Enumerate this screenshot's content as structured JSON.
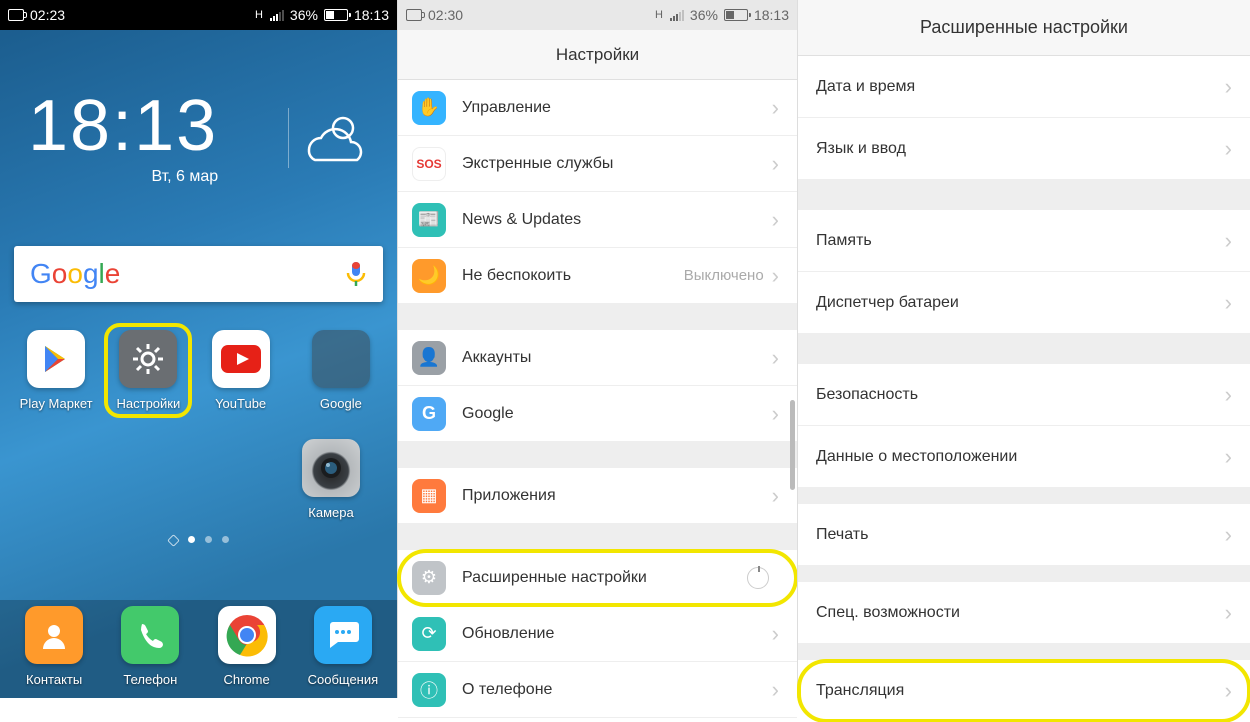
{
  "panel1": {
    "status": {
      "rec_time": "02:23",
      "signal_label": "H",
      "battery_pct": "36%",
      "clock": "18:13"
    },
    "clock": {
      "time": "18:13",
      "date": "Вт, 6 мар"
    },
    "search": {
      "logo": "Google"
    },
    "apps_row1": [
      {
        "name": "Play Маркет"
      },
      {
        "name": "Настройки"
      },
      {
        "name": "YouTube"
      },
      {
        "name": "Google"
      }
    ],
    "apps_row2": [
      {
        "name": "Камера"
      }
    ],
    "dock": [
      {
        "name": "Контакты"
      },
      {
        "name": "Телефон"
      },
      {
        "name": "Chrome"
      },
      {
        "name": "Сообщения"
      }
    ]
  },
  "panel2": {
    "status": {
      "rec_time": "02:30",
      "signal_label": "H",
      "battery_pct": "36%",
      "clock": "18:13"
    },
    "title": "Настройки",
    "items": [
      {
        "label": "Управление",
        "icon_bg": "#35b4ff",
        "glyph": "hand"
      },
      {
        "label": "Экстренные службы",
        "icon_bg": "#ffffff",
        "glyph": "sos"
      },
      {
        "label": "News & Updates",
        "icon_bg": "#2fc0b6",
        "glyph": "news"
      },
      {
        "label": "Не беспокоить",
        "icon_bg": "#ff9a2b",
        "glyph": "dnd",
        "value": "Выключено"
      }
    ],
    "items2": [
      {
        "label": "Аккаунты",
        "icon_bg": "#9aa0a6",
        "glyph": "user"
      },
      {
        "label": "Google",
        "icon_bg": "#4fa9f5",
        "glyph": "G"
      }
    ],
    "items3": [
      {
        "label": "Приложения",
        "icon_bg": "#ff7a3d",
        "glyph": "apps"
      }
    ],
    "items4": [
      {
        "label": "Расширенные настройки",
        "icon_bg": "#c0c4c8",
        "glyph": "gear",
        "highlight": true,
        "spinner": true
      },
      {
        "label": "Обновление",
        "icon_bg": "#2fc0b6",
        "glyph": "update"
      },
      {
        "label": "О телефоне",
        "icon_bg": "#2fc0b6",
        "glyph": "info"
      }
    ]
  },
  "panel3": {
    "title": "Расширенные настройки",
    "groups": [
      [
        {
          "label": "Дата и время"
        },
        {
          "label": "Язык и ввод"
        }
      ],
      [
        {
          "label": "Память"
        },
        {
          "label": "Диспетчер батареи"
        }
      ],
      [
        {
          "label": "Безопасность"
        },
        {
          "label": "Данные о местоположении"
        }
      ],
      [
        {
          "label": "Печать"
        }
      ],
      [
        {
          "label": "Спец. возможности"
        }
      ],
      [
        {
          "label": "Трансляция",
          "highlight": true
        }
      ]
    ]
  }
}
